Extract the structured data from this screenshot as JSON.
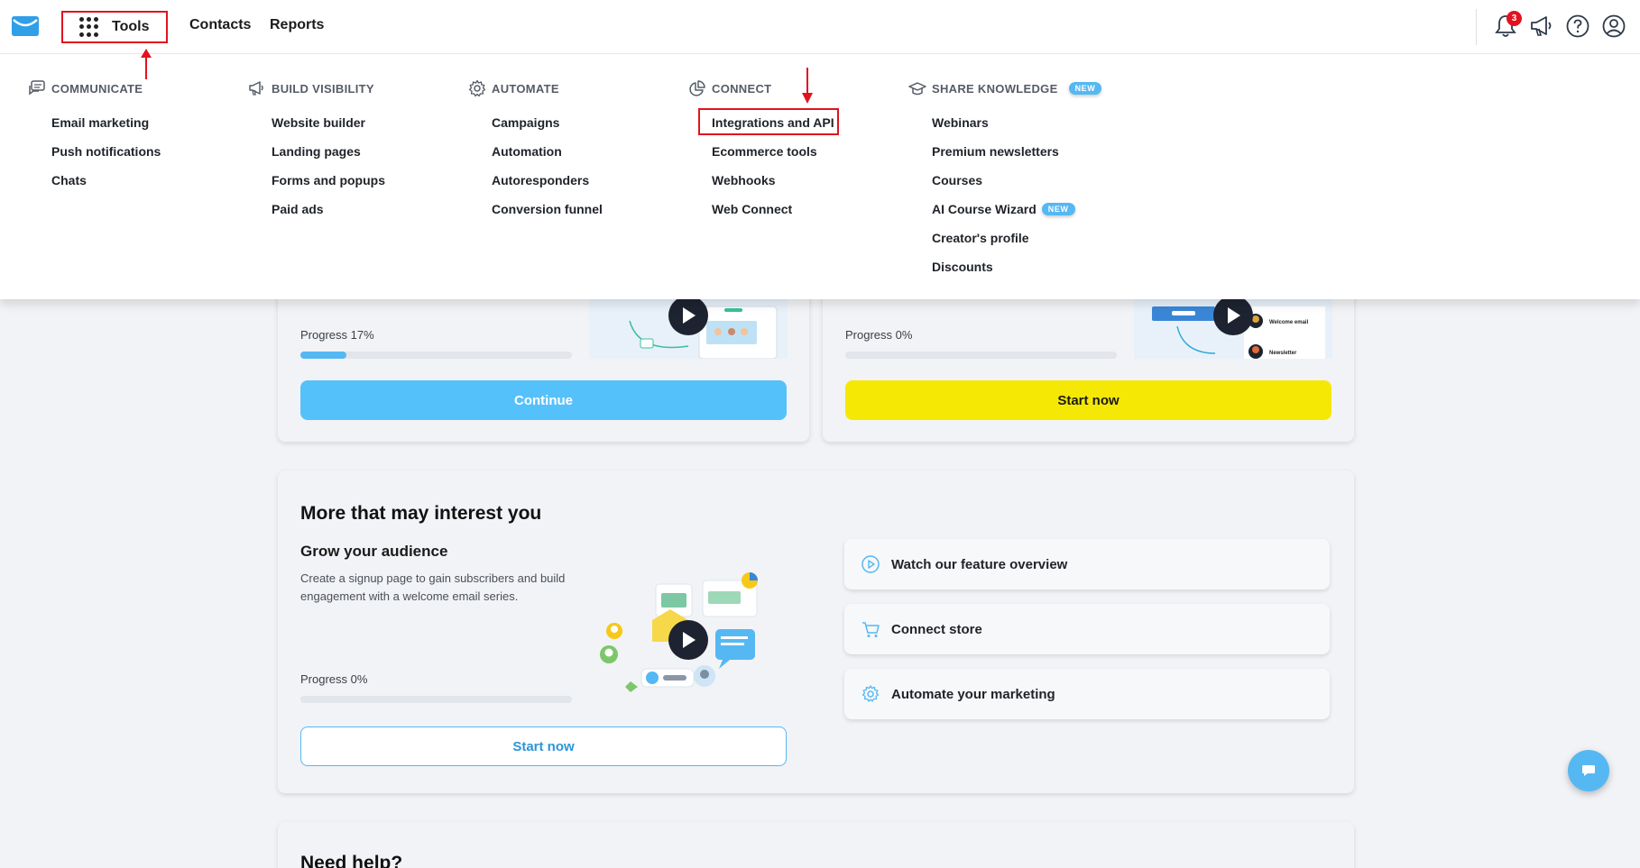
{
  "topbar": {
    "tools_label": "Tools",
    "contacts_label": "Contacts",
    "reports_label": "Reports",
    "notification_count": "3"
  },
  "menu": {
    "new_badge": "NEW",
    "columns": [
      {
        "heading": "COMMUNICATE",
        "items": [
          "Email marketing",
          "Push notifications",
          "Chats"
        ]
      },
      {
        "heading": "BUILD VISIBILITY",
        "items": [
          "Website builder",
          "Landing pages",
          "Forms and popups",
          "Paid ads"
        ]
      },
      {
        "heading": "AUTOMATE",
        "items": [
          "Campaigns",
          "Automation",
          "Autoresponders",
          "Conversion funnel"
        ]
      },
      {
        "heading": "CONNECT",
        "items": [
          "Integrations and API",
          "Ecommerce tools",
          "Webhooks",
          "Web Connect"
        ]
      },
      {
        "heading": "SHARE KNOWLEDGE",
        "items": [
          "Webinars",
          "Premium newsletters",
          "Courses",
          "AI Course Wizard",
          "Creator's profile",
          "Discounts"
        ]
      }
    ]
  },
  "cards": {
    "card1": {
      "progress_label": "Progress 17%",
      "progress": 0.17,
      "button": "Continue"
    },
    "card2": {
      "progress_label": "Progress 0%",
      "progress": 0,
      "button": "Start now",
      "thumb_label_1": "Welcome email",
      "thumb_label_2": "Newsletter"
    },
    "card3": {
      "title": "More that may interest you",
      "subtitle": "Grow your audience",
      "description": "Create a signup page to gain subscribers and build engagement with a welcome email series.",
      "progress_label": "Progress 0%",
      "progress": 0,
      "button": "Start now",
      "links": [
        "Watch our feature overview",
        "Connect store",
        "Automate your marketing"
      ]
    },
    "card4": {
      "title": "Need help?"
    }
  },
  "colors": {
    "accent_blue": "#55b8f2",
    "yellow": "#f6e805",
    "highlight_red": "#e0131f"
  }
}
